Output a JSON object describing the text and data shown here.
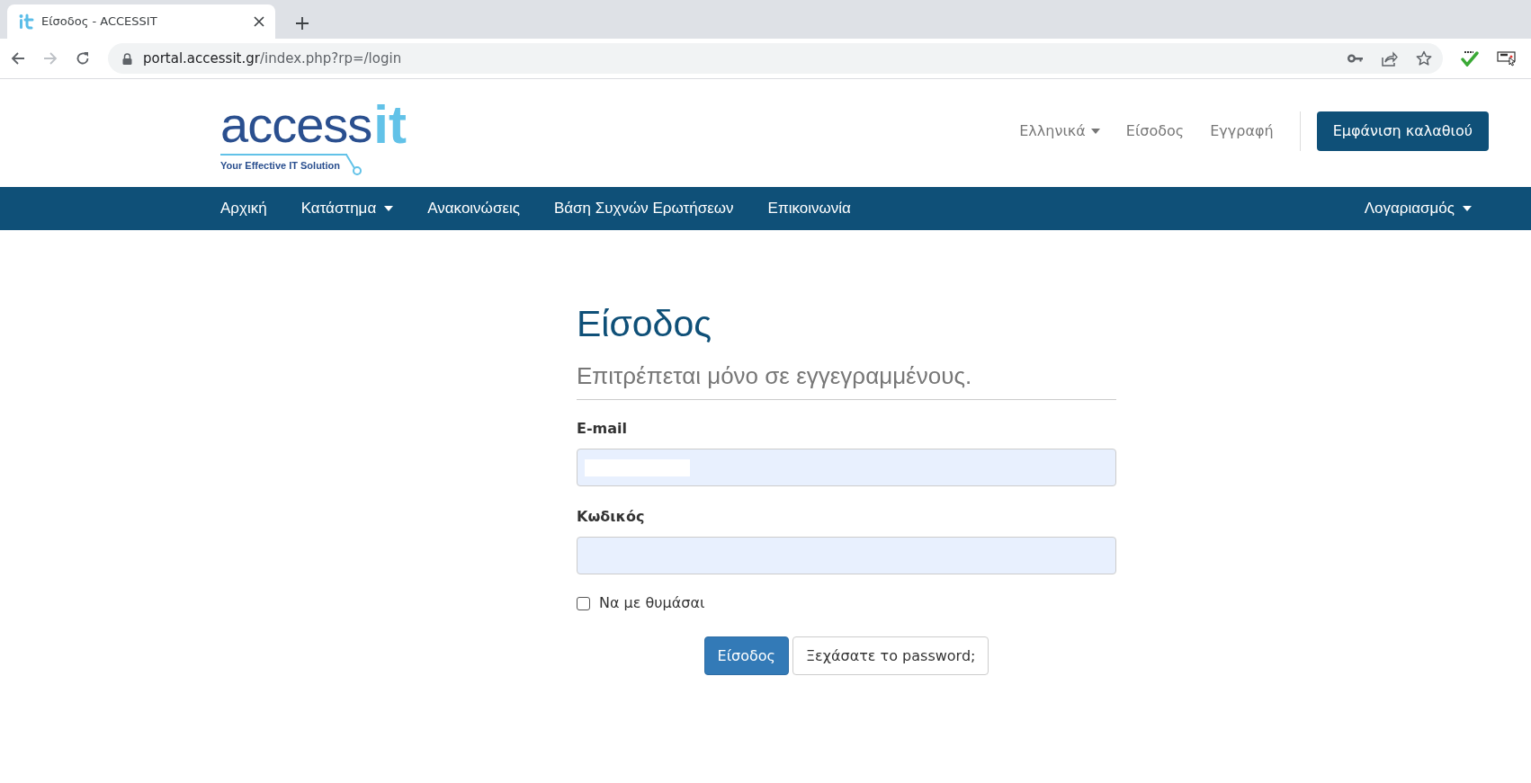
{
  "browser": {
    "tab": {
      "title": "Είσοδος - ACCESSIT"
    },
    "url": {
      "host": "portal.accessit.gr",
      "path": "/index.php?rp=/login"
    }
  },
  "logo": {
    "wordmark": "access",
    "mark": "it",
    "tagline": "Your Effective IT Solution"
  },
  "top_links": [
    {
      "label": "Ελληνικά",
      "dropdown": true
    },
    {
      "label": "Είσοδος",
      "dropdown": false
    },
    {
      "label": "Εγγραφή",
      "dropdown": false
    }
  ],
  "cart_button": "Εμφάνιση καλαθιού",
  "nav": {
    "left": [
      {
        "label": "Αρχική",
        "dropdown": false
      },
      {
        "label": "Κατάστημα",
        "dropdown": true
      },
      {
        "label": "Ανακοινώσεις",
        "dropdown": false
      },
      {
        "label": "Βάση Συχνών Ερωτήσεων",
        "dropdown": false
      },
      {
        "label": "Επικοινωνία",
        "dropdown": false
      }
    ],
    "right": [
      {
        "label": "Λογαριασμός",
        "dropdown": true
      }
    ]
  },
  "login": {
    "title": "Είσοδος",
    "subtitle": "Επιτρέπεται μόνο σε εγγεγραμμένους.",
    "fields": [
      {
        "label": "E-mail",
        "redacted": true
      },
      {
        "label": "Κωδικός"
      }
    ],
    "remember": {
      "label": "Να με θυμάσαι",
      "checked": false
    },
    "buttons": [
      {
        "label": "Είσοδος",
        "kind": "primary"
      },
      {
        "label": "Ξεχάσατε το password;",
        "kind": "default"
      }
    ]
  }
}
